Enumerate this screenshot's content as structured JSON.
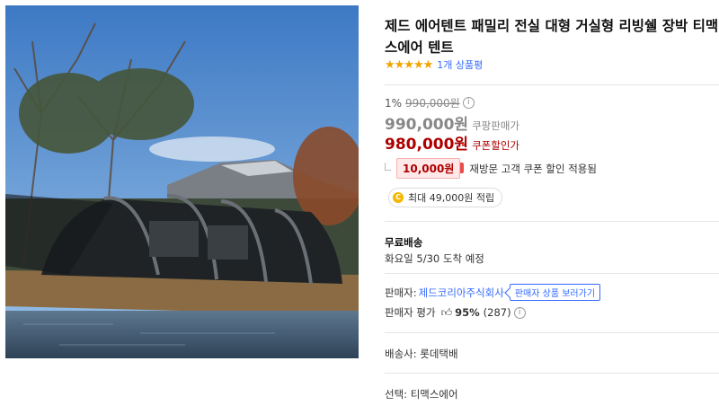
{
  "product": {
    "title": "제드 에어텐트 패밀리 전실 대형 거실형 리빙쉘 장박 티맥스에어 텐트",
    "stars": "★★★★★",
    "review_count": "1개 상품평",
    "rating": 5
  },
  "price": {
    "discount_rate": "1%",
    "original": "990,000원",
    "coupang_price": "990,000원",
    "coupang_label": "쿠팡판매가",
    "coupon_price": "980,000원",
    "coupon_label": "쿠폰할인가",
    "coupon_amount": "10,000원",
    "coupon_desc": "재방문 고객 쿠폰 할인 적용됨",
    "points_icon": "C",
    "points": "최대 49,000원 적립"
  },
  "shipping": {
    "title": "무료배송",
    "arrival": "화요일 5/30 도착 예정"
  },
  "seller": {
    "label": "판매자:",
    "name": "제드코리아주식회사",
    "products_button": "판매자 상품 보러가기",
    "rating_label": "판매자 평가",
    "rating_pct": "95%",
    "rating_count": "(287)"
  },
  "courier": "배송사: 롯데택배",
  "option": "선택: 티맥스에어",
  "colors": {
    "accent_red": "#ae0000",
    "link_blue": "#346aff",
    "star": "#f2a400"
  }
}
